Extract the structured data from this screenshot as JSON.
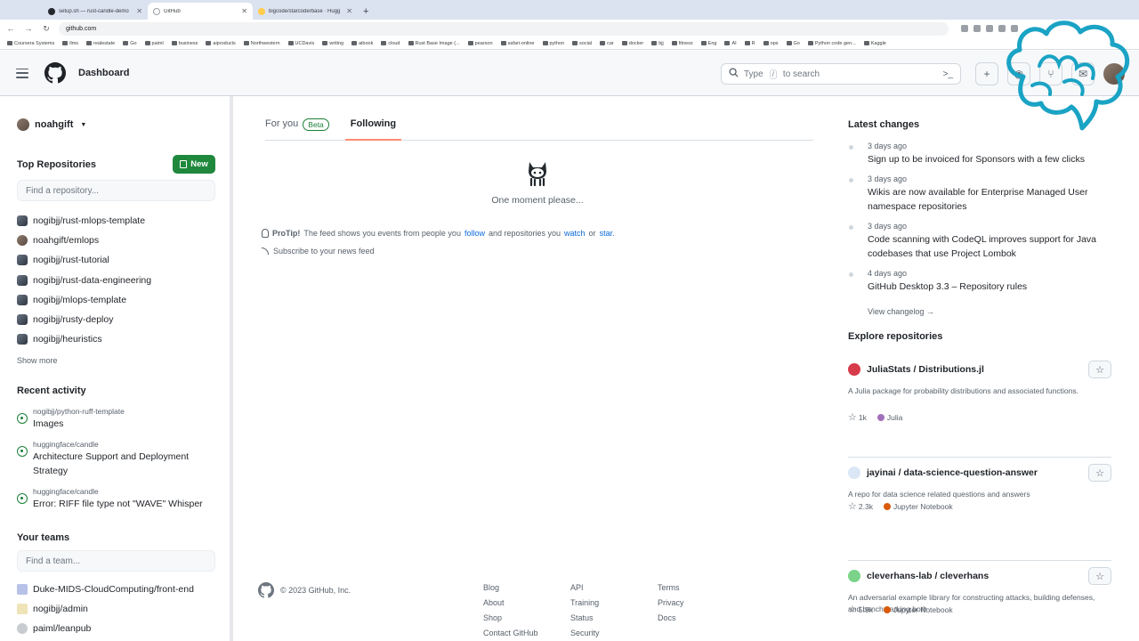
{
  "browser": {
    "tabs": [
      {
        "title": "setup.sh — rust-candle-demo",
        "active": false,
        "icon": "github"
      },
      {
        "title": "GitHub",
        "active": true,
        "icon": "github"
      },
      {
        "title": "bigcode/starcoderbase · Hugg",
        "active": false,
        "icon": "huggingface"
      }
    ],
    "new_tab": "+",
    "url": "github.com",
    "bookmarks": [
      "Coursera Systems",
      "llms",
      "realestate",
      "Go",
      "paiml",
      "business",
      "aiproducts",
      "Northwestern",
      "UCDavis",
      "writing",
      "aibook",
      "cloud",
      "Rust Base Image (...",
      "pearson",
      "safari-online",
      "python",
      "social",
      "car",
      "docker",
      "bjj",
      "fitness",
      "Eng",
      "AI",
      "R",
      "ops",
      "Go",
      "Python code gen...",
      "Kaggle"
    ]
  },
  "header": {
    "context": "Dashboard",
    "search_prefix": "Type",
    "search_key": "/",
    "search_suffix": "to search",
    "plus": "+"
  },
  "sidebar": {
    "username": "noahgift",
    "top_repos_title": "Top Repositories",
    "new_label": "New",
    "repo_filter_placeholder": "Find a repository...",
    "repos": [
      "nogibjj/rust-mlops-template",
      "noahgift/emlops",
      "nogibjj/rust-tutorial",
      "nogibjj/rust-data-engineering",
      "nogibjj/mlops-template",
      "nogibjj/rusty-deploy",
      "nogibjj/heuristics"
    ],
    "show_more": "Show more",
    "recent_title": "Recent activity",
    "activity": [
      {
        "repo": "nogibjj/python-ruff-template",
        "title": "Images"
      },
      {
        "repo": "huggingface/candle",
        "title": "Architecture Support and Deployment Strategy"
      },
      {
        "repo": "huggingface/candle",
        "title": "Error: RIFF file type not \"WAVE\" Whisper"
      }
    ],
    "teams_title": "Your teams",
    "team_filter_placeholder": "Find a team...",
    "teams": [
      "Duke-MIDS-CloudComputing/front-end",
      "nogibjj/admin",
      "paiml/leanpub"
    ]
  },
  "feed": {
    "tab_for_you": "For you",
    "beta": "Beta",
    "tab_following": "Following",
    "loading": "One moment please...",
    "protip_label": "ProTip!",
    "protip_a": "The feed shows you events from people you",
    "protip_follow": "follow",
    "protip_b": "and repositories you",
    "protip_watch": "watch",
    "protip_or": "or",
    "protip_star": "star.",
    "subscribe": "Subscribe to your news feed"
  },
  "footer": {
    "copyright": "© 2023 GitHub, Inc.",
    "col1": [
      "Blog",
      "About",
      "Shop",
      "Contact GitHub"
    ],
    "col2": [
      "API",
      "Training",
      "Status",
      "Security"
    ],
    "col3": [
      "Terms",
      "Privacy",
      "Docs"
    ]
  },
  "right": {
    "latest_title": "Latest changes",
    "changes": [
      {
        "when": "3 days ago",
        "what": "Sign up to be invoiced for Sponsors with a few clicks"
      },
      {
        "when": "3 days ago",
        "what": "Wikis are now available for Enterprise Managed User namespace repositories"
      },
      {
        "when": "3 days ago",
        "what": "Code scanning with CodeQL improves support for Java codebases that use Project Lombok"
      },
      {
        "when": "4 days ago",
        "what": "GitHub Desktop 3.3 – Repository rules"
      }
    ],
    "view_changelog": "View changelog →",
    "explore_title": "Explore repositories",
    "explore": [
      {
        "name": "JuliaStats / Distributions.jl",
        "desc": "A Julia package for probability distributions and associated functions.",
        "stars": "1k",
        "lang": "Julia",
        "lang_color": "#a270ba"
      },
      {
        "name": "jayinai / data-science-question-answer",
        "desc": "A repo for data science related questions and answers",
        "stars": "2.3k",
        "lang": "Jupyter Notebook",
        "lang_color": "#da5b0b"
      },
      {
        "name": "cleverhans-lab / cleverhans",
        "desc": "An adversarial example library for constructing attacks, building defenses, and benchmarking both",
        "stars": "5.9k",
        "lang": "Jupyter Notebook",
        "lang_color": "#da5b0b"
      }
    ]
  },
  "colors": {
    "new_button": "#1f883d",
    "link": "#0969da",
    "active_tab_underline": "#fd8c73",
    "watermark": "#1aa3c4"
  }
}
